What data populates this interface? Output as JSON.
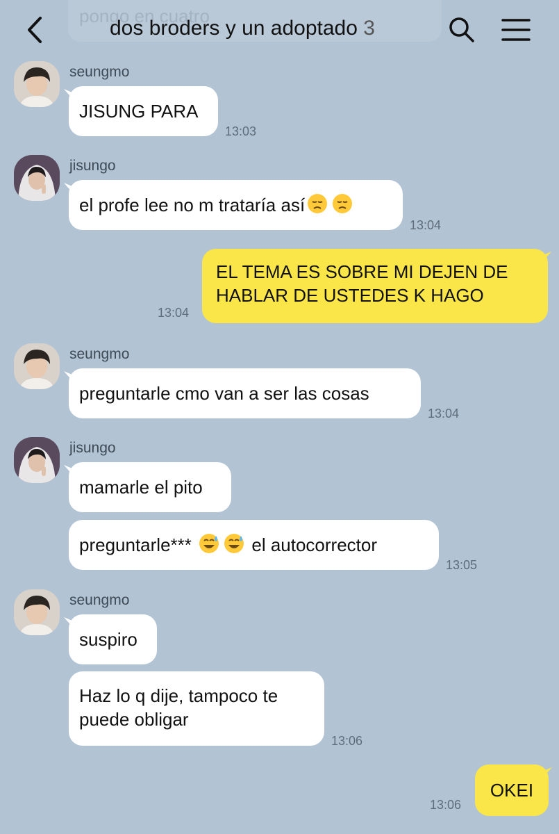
{
  "header": {
    "title": "dos broders y un adoptado",
    "member_count": "3",
    "back_icon": "chevron-left-icon",
    "search_icon": "search-icon",
    "menu_icon": "hamburger-menu-icon",
    "previous_message_fragment": "pongo en cuatro"
  },
  "colors": {
    "background": "#b2c3d3",
    "incoming_bubble": "#ffffff",
    "outgoing_bubble": "#fbe64a"
  },
  "messages": [
    {
      "sender": "seungmo",
      "text": "JISUNG PARA",
      "time": "13:03"
    },
    {
      "sender": "jisungo",
      "text": "el profe lee no m trataría así",
      "emoji": [
        "disappointed-face",
        "disappointed-face"
      ],
      "time": "13:04"
    },
    {
      "sender": "me",
      "line1": "EL TEMA ES SOBRE MI DEJEN DE",
      "line2": "HABLAR DE USTEDES K HAGO",
      "time": "13:04"
    },
    {
      "sender": "seungmo",
      "text": "preguntarle cmo van a ser las cosas",
      "time": "13:04"
    },
    {
      "sender": "jisungo",
      "text": "mamarle el pito"
    },
    {
      "sender": "jisungo",
      "text_before": "preguntarle***",
      "emoji": [
        "grinning-sweat-face",
        "grinning-sweat-face"
      ],
      "text_after": "el autocorrector",
      "time": "13:05"
    },
    {
      "sender": "seungmo",
      "text": "suspiro"
    },
    {
      "sender": "seungmo",
      "line1": "Haz lo q dije, tampoco te",
      "line2": "puede obligar",
      "time": "13:06"
    },
    {
      "sender": "me",
      "text": "OKEI",
      "time": "13:06"
    }
  ]
}
